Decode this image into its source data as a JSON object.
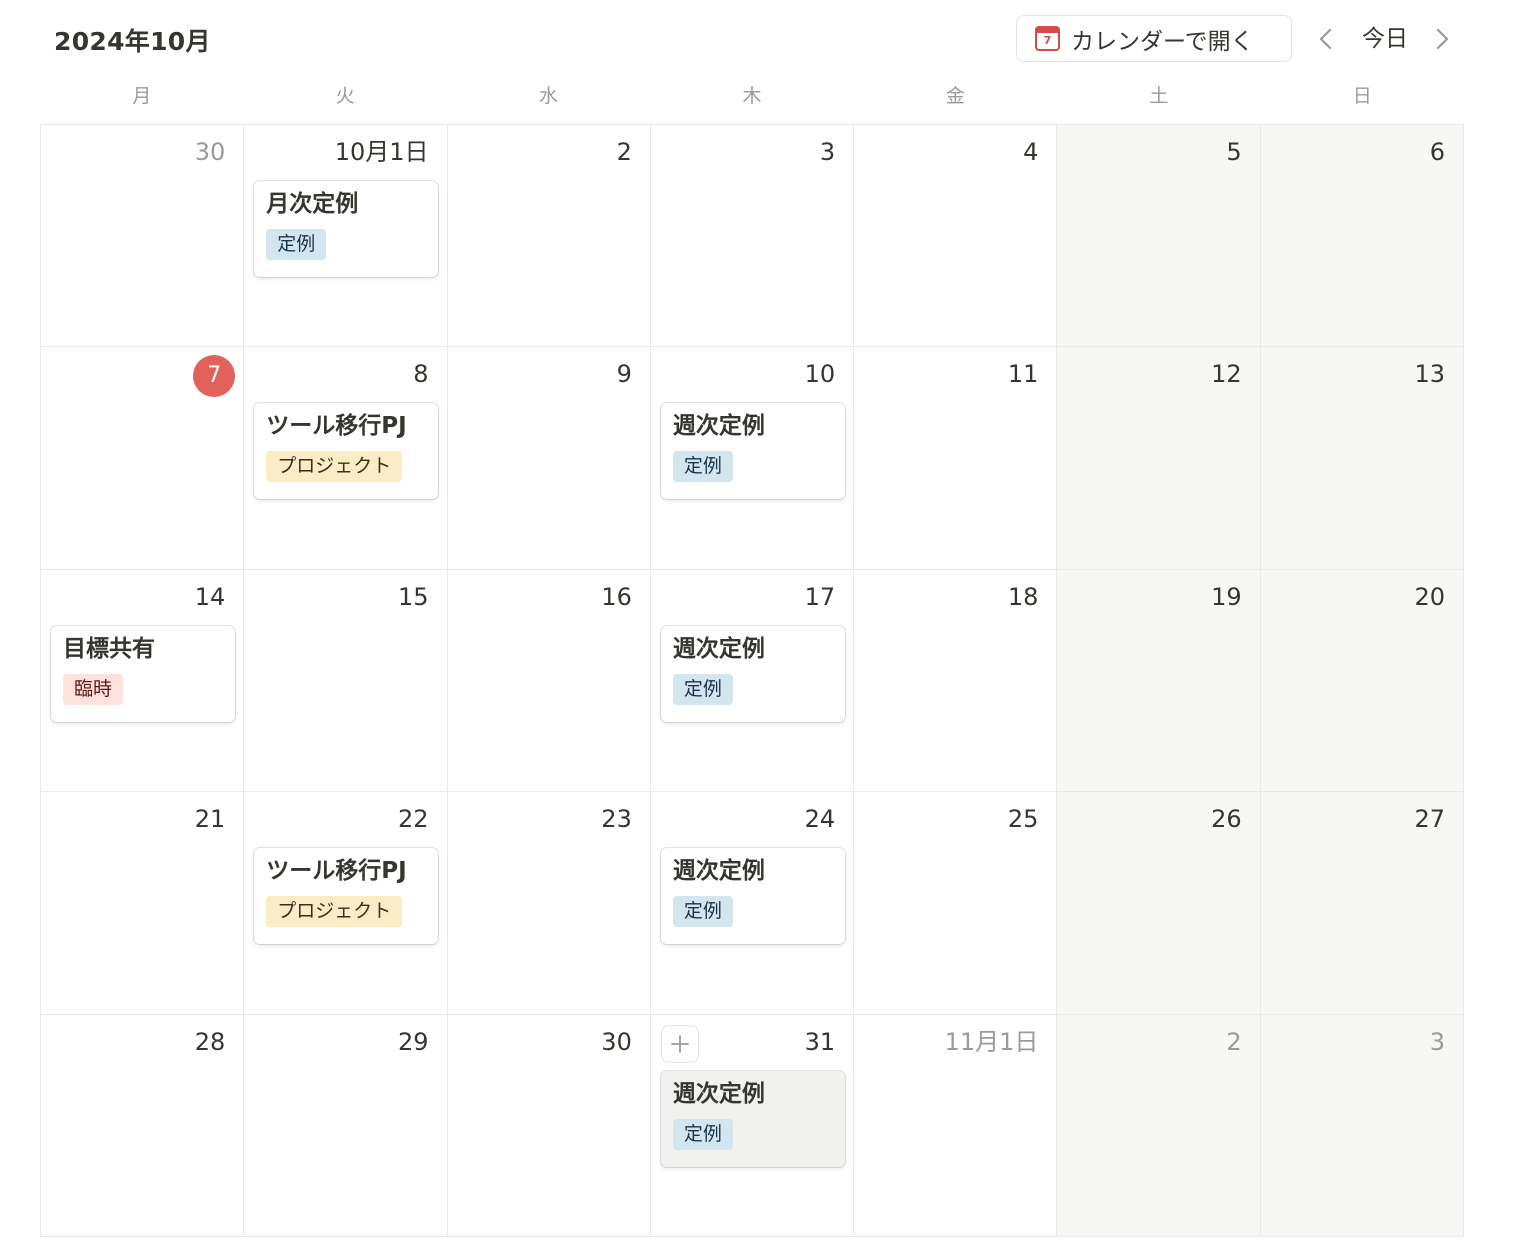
{
  "header": {
    "month_title": "2024年10月",
    "open_calendar_label": "カレンダーで開く",
    "calendar_icon_day": "7",
    "today_label": "今日"
  },
  "weekdays": [
    "月",
    "火",
    "水",
    "木",
    "金",
    "土",
    "日"
  ],
  "tag_colors": {
    "定例": {
      "bg": "#d3e5ef",
      "fg": "#183347"
    },
    "プロジェクト": {
      "bg": "#fbecc6",
      "fg": "#402c1b"
    },
    "臨時": {
      "bg": "#ffe2dd",
      "fg": "#5d1715"
    }
  },
  "accent_colors": {
    "today_circle": "#e0625b",
    "calendar_icon": "#d44c47",
    "weekend_bg": "#f7f7f5"
  },
  "weeks": [
    [
      {
        "label": "30",
        "muted": true
      },
      {
        "label": "10月1日",
        "events": [
          {
            "title": "月次定例",
            "tag": "定例"
          }
        ]
      },
      {
        "label": "2"
      },
      {
        "label": "3"
      },
      {
        "label": "4"
      },
      {
        "label": "5"
      },
      {
        "label": "6"
      }
    ],
    [
      {
        "label": "7",
        "today": true
      },
      {
        "label": "8",
        "events": [
          {
            "title": "ツール移行PJ",
            "tag": "プロジェクト"
          }
        ]
      },
      {
        "label": "9"
      },
      {
        "label": "10",
        "events": [
          {
            "title": "週次定例",
            "tag": "定例"
          }
        ]
      },
      {
        "label": "11"
      },
      {
        "label": "12"
      },
      {
        "label": "13"
      }
    ],
    [
      {
        "label": "14",
        "events": [
          {
            "title": "目標共有",
            "tag": "臨時"
          }
        ]
      },
      {
        "label": "15"
      },
      {
        "label": "16"
      },
      {
        "label": "17",
        "events": [
          {
            "title": "週次定例",
            "tag": "定例"
          }
        ]
      },
      {
        "label": "18"
      },
      {
        "label": "19"
      },
      {
        "label": "20"
      }
    ],
    [
      {
        "label": "21"
      },
      {
        "label": "22",
        "events": [
          {
            "title": "ツール移行PJ",
            "tag": "プロジェクト"
          }
        ]
      },
      {
        "label": "23"
      },
      {
        "label": "24",
        "events": [
          {
            "title": "週次定例",
            "tag": "定例"
          }
        ]
      },
      {
        "label": "25"
      },
      {
        "label": "26"
      },
      {
        "label": "27"
      }
    ],
    [
      {
        "label": "28"
      },
      {
        "label": "29"
      },
      {
        "label": "30"
      },
      {
        "label": "31",
        "add_button": true,
        "events": [
          {
            "title": "週次定例",
            "tag": "定例",
            "hover": true
          }
        ]
      },
      {
        "label": "11月1日",
        "muted": true
      },
      {
        "label": "2",
        "muted": true
      },
      {
        "label": "3",
        "muted": true
      }
    ]
  ]
}
